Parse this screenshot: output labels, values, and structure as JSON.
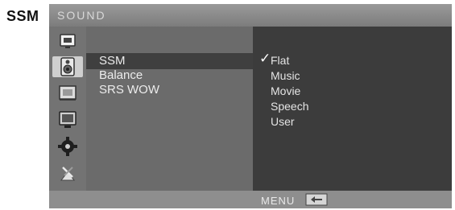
{
  "side_label": "SSM",
  "osd": {
    "title": "SOUND",
    "icons": [
      {
        "name": "picture-icon"
      },
      {
        "name": "sound-icon",
        "selected": true
      },
      {
        "name": "time-icon"
      },
      {
        "name": "screen-icon"
      },
      {
        "name": "setup-icon"
      },
      {
        "name": "lock-icon"
      }
    ],
    "menu_items": [
      "SSM",
      "Balance",
      "SRS WOW"
    ],
    "selected_menu_index": 0,
    "ssm_options": [
      "Flat",
      "Music",
      "Movie",
      "Speech",
      "User"
    ],
    "checked_option": "Flat",
    "check_mark": "✓",
    "footer_label": "MENU"
  },
  "colors": {
    "title_bar": "#8a8a8a",
    "menu_panel": "#6b6b6b",
    "submenu_panel": "#3c3c3c",
    "highlight": "#3f3f3f",
    "bottom_bar": "#8e8e8e"
  }
}
